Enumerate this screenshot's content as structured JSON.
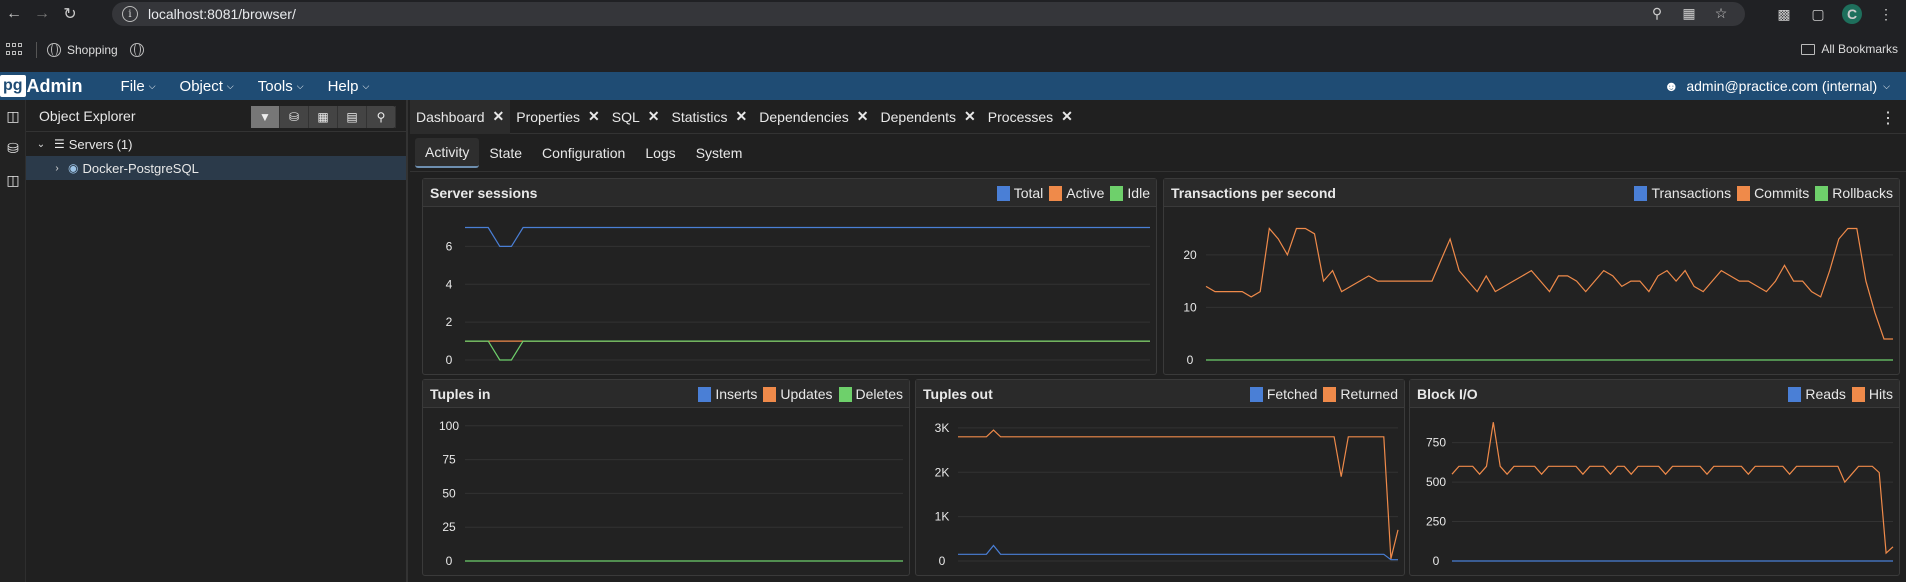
{
  "browser": {
    "url": "localhost:8081/browser/",
    "bookmark_shopping": "Shopping",
    "all_bookmarks": "All Bookmarks",
    "profile_initial": "C"
  },
  "pgadmin": {
    "logo_pg": "pg",
    "logo_admin": "Admin",
    "menu": [
      "File",
      "Object",
      "Tools",
      "Help"
    ],
    "user": "admin@practice.com (internal)"
  },
  "explorer": {
    "title": "Object Explorer",
    "servers_label": "Servers",
    "servers_count": "(1)",
    "server_name": "Docker-PostgreSQL"
  },
  "tabs": [
    "Dashboard",
    "Properties",
    "SQL",
    "Statistics",
    "Dependencies",
    "Dependents",
    "Processes"
  ],
  "subtabs": [
    "Activity",
    "State",
    "Configuration",
    "Logs",
    "System"
  ],
  "colors": {
    "blue": "#4a7fd6",
    "orange": "#ef8a4a",
    "green": "#6ed06b",
    "grid": "#333333",
    "axis_text": "#e8e8e8"
  },
  "charts": {
    "sessions": {
      "title": "Server sessions",
      "legend": [
        "Total",
        "Active",
        "Idle"
      ],
      "ylim": [
        0,
        7.5
      ],
      "ticks": [
        {
          "v": 0,
          "label": "0"
        },
        {
          "v": 2,
          "label": "2"
        },
        {
          "v": 4,
          "label": "4"
        },
        {
          "v": 6,
          "label": "6"
        }
      ],
      "series": [
        {
          "color": "blue",
          "values": [
            7,
            7,
            7,
            6,
            6,
            7,
            7,
            7,
            7,
            7,
            7,
            7,
            7,
            7,
            7,
            7,
            7,
            7,
            7,
            7,
            7,
            7,
            7,
            7,
            7,
            7,
            7,
            7,
            7,
            7,
            7,
            7,
            7,
            7,
            7,
            7,
            7,
            7,
            7,
            7,
            7,
            7,
            7,
            7,
            7,
            7,
            7,
            7,
            7,
            7,
            7,
            7,
            7,
            7,
            7,
            7,
            7,
            7,
            7,
            7
          ]
        },
        {
          "color": "orange",
          "values": [
            1,
            1,
            1,
            1,
            1,
            1,
            1,
            1,
            1,
            1,
            1,
            1,
            1,
            1,
            1,
            1,
            1,
            1,
            1,
            1,
            1,
            1,
            1,
            1,
            1,
            1,
            1,
            1,
            1,
            1,
            1,
            1,
            1,
            1,
            1,
            1,
            1,
            1,
            1,
            1,
            1,
            1,
            1,
            1,
            1,
            1,
            1,
            1,
            1,
            1,
            1,
            1,
            1,
            1,
            1,
            1,
            1,
            1,
            1,
            1
          ]
        },
        {
          "color": "green",
          "values": [
            1,
            1,
            1,
            0,
            0,
            1,
            1,
            1,
            1,
            1,
            1,
            1,
            1,
            1,
            1,
            1,
            1,
            1,
            1,
            1,
            1,
            1,
            1,
            1,
            1,
            1,
            1,
            1,
            1,
            1,
            1,
            1,
            1,
            1,
            1,
            1,
            1,
            1,
            1,
            1,
            1,
            1,
            1,
            1,
            1,
            1,
            1,
            1,
            1,
            1,
            1,
            1,
            1,
            1,
            1,
            1,
            1,
            1,
            1,
            1
          ]
        }
      ]
    },
    "transactions": {
      "title": "Transactions per second",
      "legend": [
        "Transactions",
        "Commits",
        "Rollbacks"
      ],
      "ylim": [
        0,
        27
      ],
      "ticks": [
        {
          "v": 0,
          "label": "0"
        },
        {
          "v": 10,
          "label": "10"
        },
        {
          "v": 20,
          "label": "20"
        }
      ],
      "series": [
        {
          "color": "orange",
          "values": [
            14,
            13,
            13,
            13,
            13,
            12,
            13,
            25,
            23,
            20,
            25,
            25,
            24,
            15,
            17,
            13,
            14,
            15,
            16,
            15,
            15,
            15,
            15,
            15,
            15,
            15,
            19,
            23,
            17,
            15,
            13,
            16,
            13,
            14,
            15,
            16,
            17,
            15,
            13,
            16,
            16,
            15,
            13,
            15,
            17,
            16,
            14,
            15,
            15,
            13,
            16,
            17,
            15,
            17,
            14,
            13,
            15,
            17,
            16,
            15,
            15,
            14,
            13,
            15,
            18,
            15,
            15,
            13,
            12,
            17,
            23,
            25,
            25,
            15,
            9,
            4,
            4
          ]
        },
        {
          "color": "green",
          "values": [
            0,
            0,
            0,
            0,
            0,
            0,
            0,
            0,
            0,
            0,
            0,
            0,
            0,
            0,
            0,
            0,
            0,
            0,
            0,
            0,
            0,
            0,
            0,
            0,
            0,
            0,
            0,
            0,
            0,
            0,
            0,
            0,
            0,
            0,
            0,
            0,
            0,
            0,
            0,
            0,
            0,
            0,
            0,
            0,
            0,
            0,
            0,
            0,
            0,
            0,
            0,
            0,
            0,
            0,
            0,
            0,
            0,
            0,
            0,
            0,
            0,
            0,
            0,
            0,
            0,
            0,
            0,
            0,
            0,
            0,
            0,
            0,
            0,
            0,
            0,
            0,
            0
          ]
        }
      ]
    },
    "tuples_in": {
      "title": "Tuples in",
      "legend": [
        "Inserts",
        "Updates",
        "Deletes"
      ],
      "ylim": [
        0,
        105
      ],
      "ticks": [
        {
          "v": 0,
          "label": "0"
        },
        {
          "v": 25,
          "label": "25"
        },
        {
          "v": 50,
          "label": "50"
        },
        {
          "v": 75,
          "label": "75"
        },
        {
          "v": 100,
          "label": "100"
        }
      ],
      "series": [
        {
          "color": "green",
          "values": [
            0,
            0,
            0,
            0,
            0,
            0,
            0,
            0,
            0,
            0,
            0,
            0,
            0,
            0,
            0,
            0,
            0,
            0,
            0,
            0
          ]
        }
      ]
    },
    "tuples_out": {
      "title": "Tuples out",
      "legend": [
        "Fetched",
        "Returned"
      ],
      "ylim": [
        0,
        3200
      ],
      "ticks": [
        {
          "v": 0,
          "label": "0"
        },
        {
          "v": 1000,
          "label": "1K"
        },
        {
          "v": 2000,
          "label": "2K"
        },
        {
          "v": 3000,
          "label": "3K"
        }
      ],
      "series": [
        {
          "color": "orange",
          "values": [
            2800,
            2800,
            2800,
            2800,
            2800,
            2950,
            2800,
            2800,
            2800,
            2800,
            2800,
            2800,
            2800,
            2800,
            2800,
            2800,
            2800,
            2800,
            2800,
            2800,
            2800,
            2800,
            2800,
            2800,
            2800,
            2800,
            2800,
            2800,
            2800,
            2800,
            2800,
            2800,
            2800,
            2800,
            2800,
            2800,
            2800,
            2800,
            2800,
            2800,
            2800,
            2800,
            2800,
            2800,
            2800,
            2800,
            2800,
            2800,
            2800,
            2800,
            2800,
            2800,
            2800,
            2800,
            1900,
            2800,
            2800,
            2800,
            2800,
            2800,
            2800,
            50,
            700
          ]
        },
        {
          "color": "blue",
          "values": [
            150,
            150,
            150,
            150,
            150,
            350,
            150,
            150,
            150,
            150,
            150,
            150,
            150,
            150,
            150,
            150,
            150,
            150,
            150,
            150,
            150,
            150,
            150,
            150,
            150,
            150,
            150,
            150,
            150,
            150,
            150,
            150,
            150,
            150,
            150,
            150,
            150,
            150,
            150,
            150,
            150,
            150,
            150,
            150,
            150,
            150,
            150,
            150,
            150,
            150,
            150,
            150,
            150,
            150,
            150,
            150,
            150,
            150,
            150,
            150,
            150,
            30,
            30
          ]
        }
      ]
    },
    "block_io": {
      "title": "Block I/O",
      "legend": [
        "Reads",
        "Hits"
      ],
      "ylim": [
        0,
        900
      ],
      "ticks": [
        {
          "v": 0,
          "label": "0"
        },
        {
          "v": 250,
          "label": "250"
        },
        {
          "v": 500,
          "label": "500"
        },
        {
          "v": 750,
          "label": "750"
        }
      ],
      "series": [
        {
          "color": "orange",
          "values": [
            550,
            600,
            600,
            600,
            550,
            600,
            880,
            600,
            550,
            600,
            600,
            600,
            600,
            550,
            600,
            600,
            600,
            600,
            600,
            550,
            600,
            600,
            600,
            550,
            600,
            600,
            550,
            600,
            600,
            600,
            600,
            550,
            600,
            600,
            600,
            600,
            600,
            550,
            600,
            600,
            600,
            600,
            600,
            550,
            600,
            600,
            600,
            600,
            600,
            550,
            600,
            600,
            600,
            600,
            600,
            600,
            600,
            500,
            550,
            600,
            600,
            600,
            560,
            50,
            90
          ]
        },
        {
          "color": "blue",
          "values": [
            0,
            0,
            0,
            0,
            0,
            0,
            0,
            0,
            0,
            0,
            0,
            0,
            0,
            0,
            0,
            0,
            0,
            0,
            0,
            0,
            0,
            0,
            0,
            0,
            0,
            0,
            0,
            0,
            0,
            0,
            0,
            0,
            0,
            0,
            0,
            0,
            0,
            0,
            0,
            0,
            0,
            0,
            0,
            0,
            0,
            0,
            0,
            0,
            0,
            0,
            0,
            0,
            0,
            0,
            0,
            0,
            0,
            0,
            0,
            0,
            0,
            0,
            0,
            0,
            0
          ]
        }
      ]
    }
  }
}
